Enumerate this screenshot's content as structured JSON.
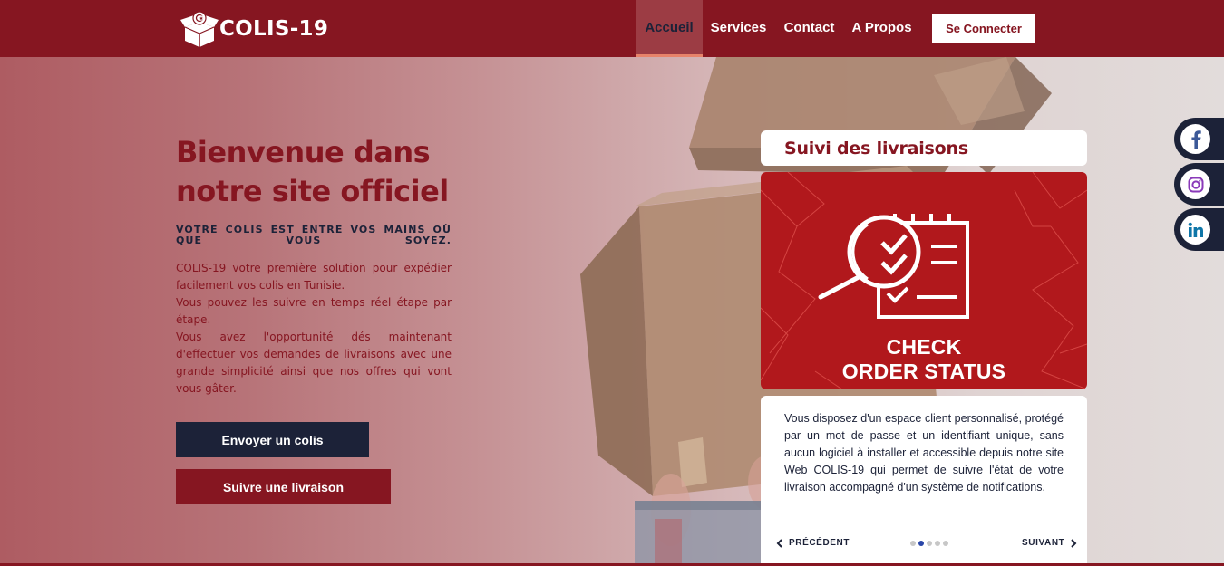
{
  "brand": {
    "name": "COLIS-19"
  },
  "nav": {
    "items": [
      {
        "label": "Accueil",
        "active": true
      },
      {
        "label": "Services"
      },
      {
        "label": "Contact"
      },
      {
        "label": "A Propos"
      }
    ],
    "connect_label": "Se Connecter"
  },
  "hero": {
    "title": "Bienvenue dans notre site officiel",
    "tagline": "VOTRE COLIS EST ENTRE VOS MAINS OÙ QUE VOUS SOYEZ.",
    "paragraphs": [
      "COLIS-19 votre première solution pour expédier facilement vos colis en Tunisie.",
      "Vous pouvez les suivre en temps réel étape par étape.",
      "Vous avez l'opportunité dés maintenant d'effectuer vos demandes de livraisons avec une grande simplicité ainsi que nos offres qui vont vous gâter."
    ],
    "send_button": "Envoyer un colis",
    "track_button": "Suivre une livraison"
  },
  "tracking": {
    "title": "Suivi des livraisons",
    "image_line1": "CHECK",
    "image_line2": "ORDER STATUS",
    "description": "Vous disposez d'un espace client personnalisé, protégé par un mot de passe et un identifiant unique, sans aucun logiciel à installer et accessible depuis notre site Web COLIS-19 qui permet de suivre l'état de votre livraison accompagné d'un système de notifications.",
    "prev_label": "PRÉCÉDENT",
    "next_label": "SUIVANT",
    "slide_count": 5,
    "active_slide": 2
  },
  "social": [
    {
      "name": "facebook",
      "icon": "facebook-icon",
      "color": "#3b5998"
    },
    {
      "name": "instagram",
      "icon": "instagram-icon",
      "color": "#8a3ab9"
    },
    {
      "name": "linkedin",
      "icon": "linkedin-icon",
      "color": "#0e76a8"
    }
  ],
  "colors": {
    "brand_red": "#861621",
    "navy": "#1c2238",
    "panel_red": "#b1181c",
    "active_underline": "#e7836a"
  }
}
